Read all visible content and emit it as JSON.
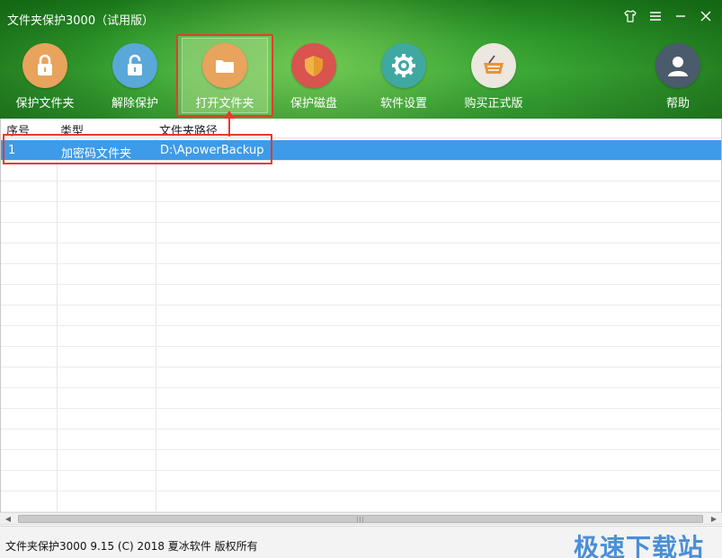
{
  "window": {
    "title": "文件夹保护3000（试用版）"
  },
  "toolbar": {
    "items": [
      {
        "label": "保护文件夹",
        "icon": "lock-closed-icon",
        "color": "#e8a35c"
      },
      {
        "label": "解除保护",
        "icon": "lock-open-icon",
        "color": "#5aa7d9"
      },
      {
        "label": "打开文件夹",
        "icon": "folder-icon",
        "color": "#e8a35c"
      },
      {
        "label": "保护磁盘",
        "icon": "shield-icon",
        "color": "#d9534f"
      },
      {
        "label": "软件设置",
        "icon": "gear-icon",
        "color": "#3fa8a0"
      },
      {
        "label": "购买正式版",
        "icon": "basket-icon",
        "color": "#e9e4dc"
      },
      {
        "label": "帮助",
        "icon": "user-icon",
        "color": "#4a5b6b"
      }
    ],
    "active_index": 2
  },
  "table": {
    "columns": [
      "序号",
      "类型",
      "文件夹路径"
    ],
    "rows": [
      {
        "index": "1",
        "type": "加密码文件夹",
        "path": "D:\\ApowerBackup",
        "selected": true
      }
    ]
  },
  "status": {
    "text": "文件夹保护3000 9.15 (C) 2018 夏冰软件 版权所有",
    "watermark": "极速下载站"
  },
  "colors": {
    "header_green": "#2f9a2c",
    "selection_blue": "#3d9be9",
    "annotation_red": "#e23d2e"
  }
}
